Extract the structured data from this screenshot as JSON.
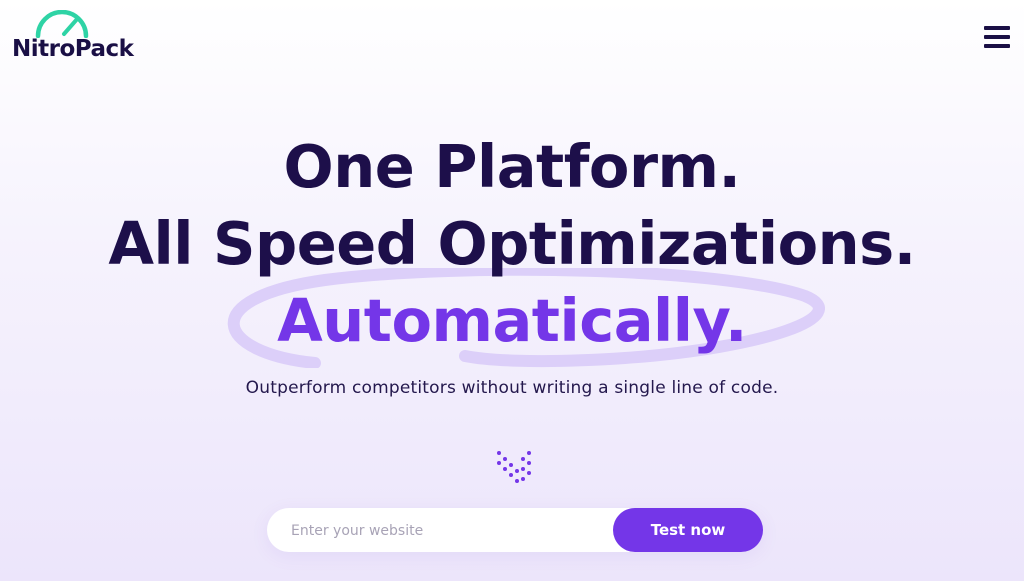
{
  "header": {
    "logo_text": "NitroPack",
    "logo_icon": "speedometer-icon",
    "menu_icon": "hamburger-menu-icon"
  },
  "hero": {
    "line1": "One Platform.",
    "line2": "All Speed Optimizations.",
    "line3": "Automatically.",
    "subtitle": "Outperform competitors without writing a single line of code."
  },
  "form": {
    "placeholder": "Enter your website",
    "button_label": "Test now"
  },
  "colors": {
    "brand_dark": "#1a0f45",
    "accent": "#7436e8",
    "logo_accent": "#2ed3a5",
    "swirl": "#dccff9"
  }
}
